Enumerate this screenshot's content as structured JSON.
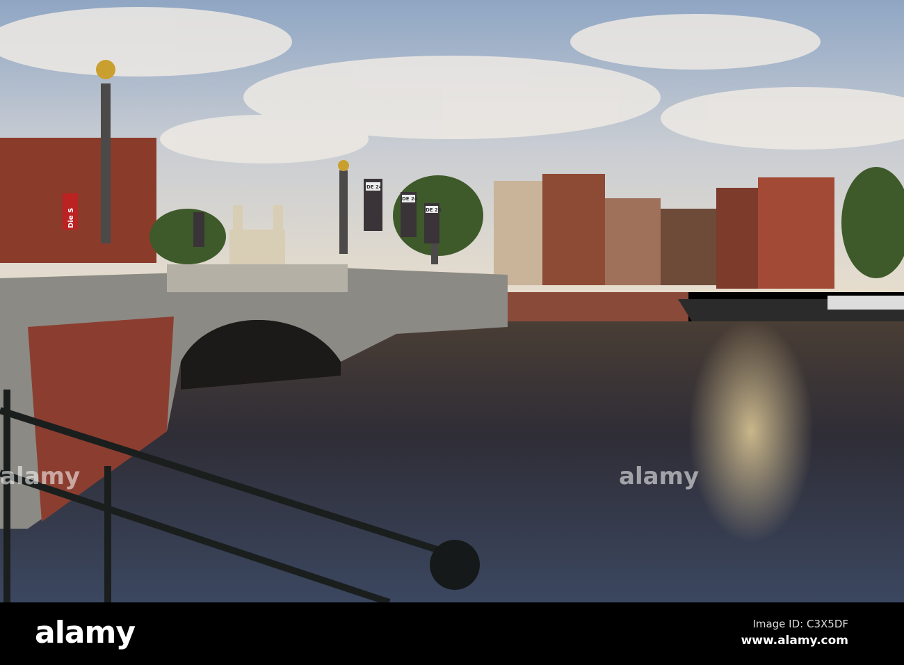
{
  "watermark": {
    "brand": "alamy",
    "image_id": "Image ID: C3X5DF",
    "url": "www.alamy.com"
  },
  "scene": {
    "banner_text": "DE 24",
    "sign_text": "Die S"
  }
}
